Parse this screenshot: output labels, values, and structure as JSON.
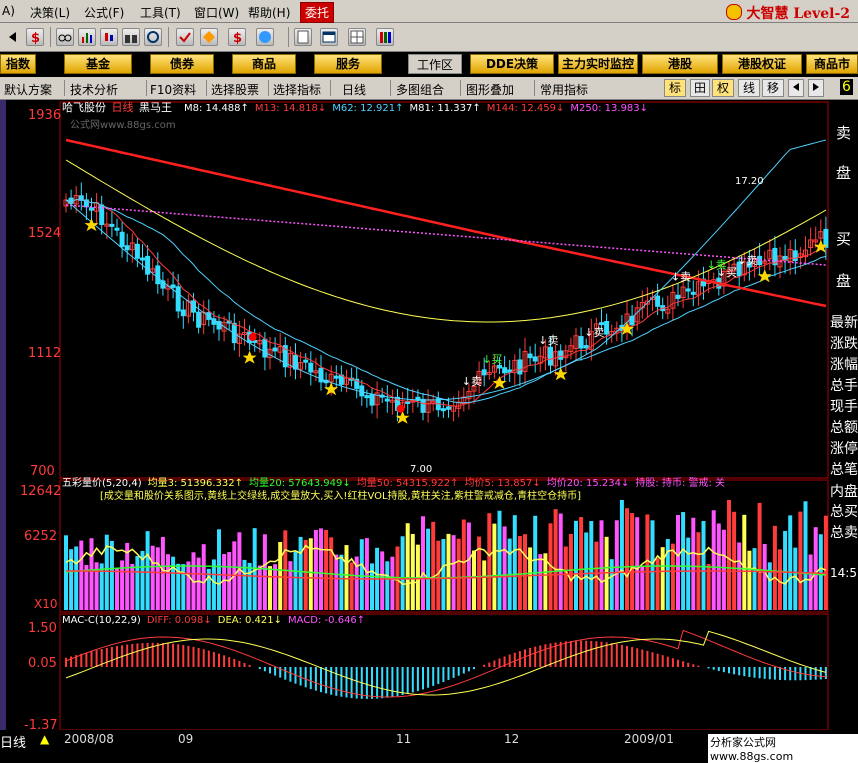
{
  "menubar": {
    "items": [
      "A)",
      "决策(L)",
      "公式(F)",
      "工具(T)",
      "窗口(W)",
      "帮助(H)"
    ],
    "weituo": "委托",
    "brand": "大智慧 Level-2"
  },
  "tabs": {
    "items": [
      "指数",
      "基金",
      "债券",
      "商品",
      "服务"
    ],
    "workzone": "工作区",
    "right_items": [
      "DDE决策",
      "主力实时监控",
      "港股",
      "港股权证",
      "商品市"
    ]
  },
  "subbar": {
    "items": [
      "默认方案",
      "技术分析",
      "F10资料",
      "选择股票",
      "选择指标",
      "日线",
      "多图组合",
      "图形叠加",
      "常用指标"
    ],
    "tools": [
      "标",
      "田",
      "权",
      "线",
      "移"
    ]
  },
  "main_chart": {
    "stock": "哈飞股份",
    "period": "日线",
    "indicator": "黑马王",
    "watermark": "公式网www.88gs.com",
    "ma_labels": [
      {
        "text": "M8: 14.488↑",
        "color": "#ffffff"
      },
      {
        "text": "M13: 14.818↓",
        "color": "#ff3b3b"
      },
      {
        "text": "M62: 12.921↑",
        "color": "#4fd2ff"
      },
      {
        "text": "M81: 11.337↑",
        "color": "#ffffff"
      },
      {
        "text": "M144: 12.459↓",
        "color": "#ff3b3b"
      },
      {
        "text": "M250: 13.983↓",
        "color": "#ff55ff"
      }
    ],
    "y_labels": [
      "1936",
      "1524",
      "1112",
      "700"
    ],
    "annotations": [
      "卖",
      "卖",
      "卖",
      "卖",
      "卖",
      "卖",
      "买",
      "买"
    ],
    "high_label": "17.20",
    "low_label": "7.00",
    "colors": {
      "bg": "#000000",
      "axis": "#c00000",
      "up": "#ff3b3b",
      "down": "#33ddff",
      "ma_red": "#ff2020",
      "ma_yellow": "#ffff55",
      "ma_cyan": "#4fd2ff",
      "ma_magenta": "#ff55ff"
    }
  },
  "volume_chart": {
    "title": "五彩量价(5,20,4)",
    "labels": [
      {
        "text": "均量3: 51396.332↑",
        "color": "#ffff55"
      },
      {
        "text": "均量20: 57643.949↓",
        "color": "#33ff33"
      },
      {
        "text": "均量50: 54315.922↑",
        "color": "#ff3b3b"
      },
      {
        "text": "均价5: 13.857↓",
        "color": "#ff3b3b"
      },
      {
        "text": "均价20: 15.234↓",
        "color": "#ff55ff"
      },
      {
        "text": "持股: 持币: 警戒: 关",
        "color": "#ff55ff"
      }
    ],
    "note": "[成交量和股价关系图示,黄线上交绿线,成交量放大,买入!红柱VOL持股,黄柱关注,紫柱警戒减仓,青柱空仓持币]",
    "y_labels": [
      "12642",
      "6252",
      "X10"
    ]
  },
  "macd_chart": {
    "title": "MAC-C(10,22,9)",
    "labels": [
      {
        "text": "DIFF: 0.098↓",
        "color": "#ff3b3b"
      },
      {
        "text": "DEA: 0.421↓",
        "color": "#ffff55"
      },
      {
        "text": "MACD: -0.646↑",
        "color": "#ff55ff"
      }
    ],
    "y_labels": [
      "1.50",
      "0.05",
      "-1.37"
    ]
  },
  "bottom": {
    "period_label": "日线",
    "dates": [
      "2008/08",
      "09",
      "11",
      "12",
      "2009/01"
    ],
    "site": "分析家公式网www.88gs.com"
  },
  "right_panel": {
    "items": [
      "卖",
      "盘",
      "买",
      "盘",
      "最新",
      "涨跌",
      "涨幅",
      "总手",
      "现手",
      "总额",
      "涨停",
      "总笔",
      "内盘",
      "总买",
      "总卖"
    ],
    "value": "6",
    "time": "14:5"
  }
}
